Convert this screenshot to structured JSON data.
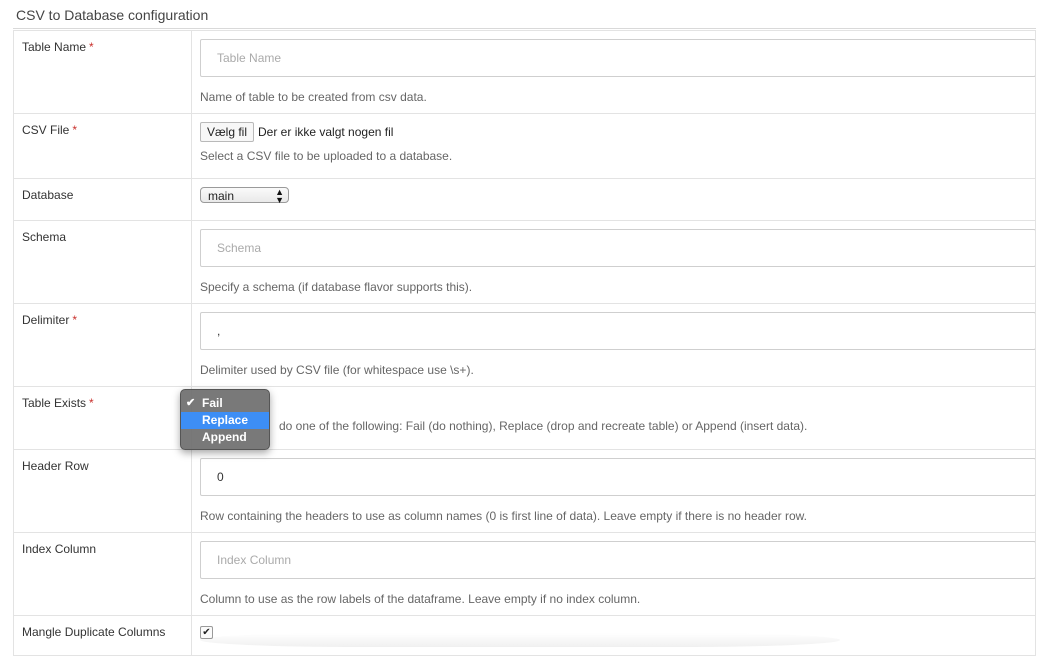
{
  "page": {
    "title": "CSV to Database configuration"
  },
  "rows": {
    "table_name": {
      "label": "Table Name",
      "required": "*",
      "placeholder": "Table Name",
      "value": "",
      "help": "Name of table to be created from csv data."
    },
    "csv_file": {
      "label": "CSV File",
      "required": "*",
      "button_label": "Vælg fil",
      "status": "Der er ikke valgt nogen fil",
      "help": "Select a CSV file to be uploaded to a database."
    },
    "database": {
      "label": "Database",
      "selected": "main"
    },
    "schema": {
      "label": "Schema",
      "placeholder": "Schema",
      "value": "",
      "help": "Specify a schema (if database flavor supports this)."
    },
    "delimiter": {
      "label": "Delimiter",
      "required": "*",
      "value": ",",
      "help": "Delimiter used by CSV file (for whitespace use \\s+)."
    },
    "table_exists": {
      "label": "Table Exists",
      "required": "*",
      "help_visible": "do one of the following: Fail (do nothing), Replace (drop and recreate table) or Append (insert data).",
      "options": [
        "Fail",
        "Replace",
        "Append"
      ],
      "selected": "Fail",
      "highlighted": "Replace"
    },
    "header_row": {
      "label": "Header Row",
      "value": "0",
      "help": "Row containing the headers to use as column names (0 is first line of data). Leave empty if there is no header row."
    },
    "index_column": {
      "label": "Index Column",
      "placeholder": "Index Column",
      "value": "",
      "help": "Column to use as the row labels of the dataframe. Leave empty if no index column."
    },
    "mangle_duplicate_columns": {
      "label": "Mangle Duplicate Columns",
      "checked": true
    }
  },
  "icons": {
    "checkmark": "check-icon",
    "select_arrows": "updown-chevron-icon"
  },
  "colors": {
    "required_marker": "#c9302c",
    "dropdown_highlight": "#3d8ef5"
  }
}
